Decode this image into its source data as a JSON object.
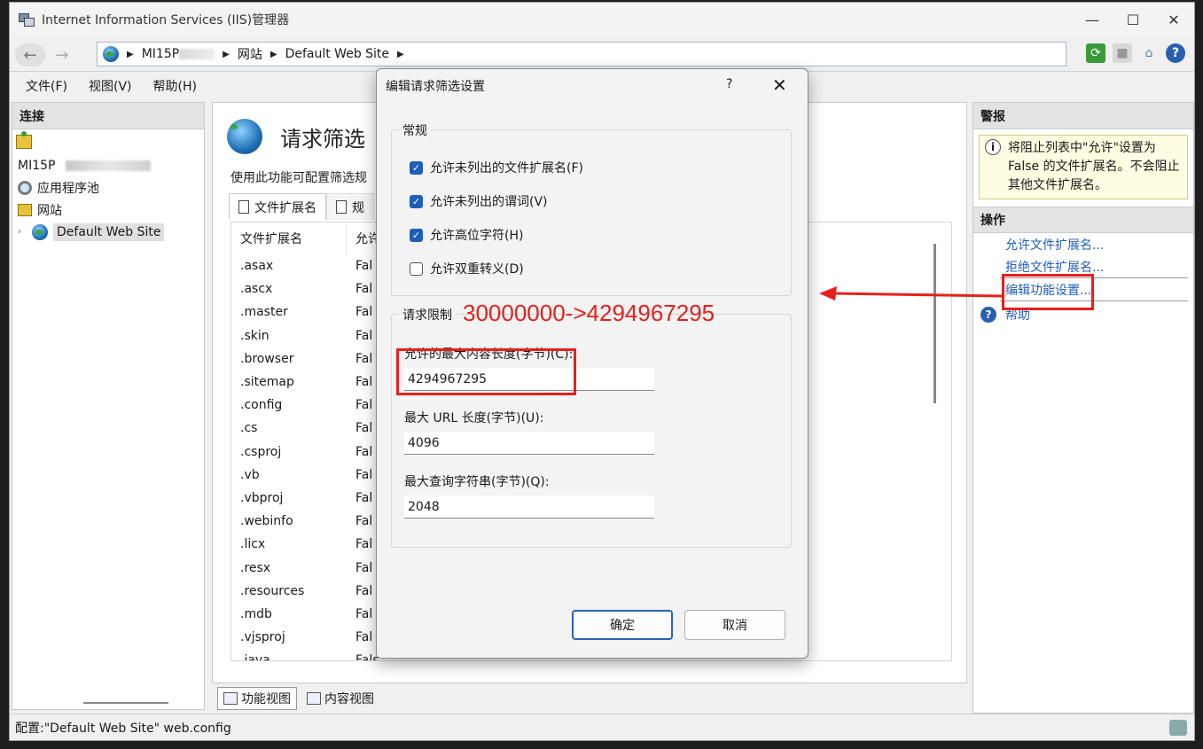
{
  "window": {
    "title": "Internet Information Services (IIS)管理器",
    "controls": {
      "minimize": "—",
      "maximize": "☐",
      "close": "✕"
    }
  },
  "address": {
    "crumbs": [
      "MI15P",
      "网站",
      "Default Web Site"
    ]
  },
  "menu": {
    "file": "文件(F)",
    "view": "视图(V)",
    "help": "帮助(H)"
  },
  "connections": {
    "header": "连接",
    "server": "MI15P",
    "app_pools": "应用程序池",
    "sites": "网站",
    "site": "Default Web Site"
  },
  "center": {
    "title": "请求筛选",
    "description": "使用此功能可配置筛选规",
    "tab_ext": "文件扩展名",
    "tab_rules": "规",
    "col_ext": "文件扩展名",
    "col_allowed": "允许",
    "rows": [
      [
        ".asax",
        "Fal"
      ],
      [
        ".ascx",
        "Fal"
      ],
      [
        ".master",
        "Fal"
      ],
      [
        ".skin",
        "Fal"
      ],
      [
        ".browser",
        "Fal"
      ],
      [
        ".sitemap",
        "Fal"
      ],
      [
        ".config",
        "Fal"
      ],
      [
        ".cs",
        "Fal"
      ],
      [
        ".csproj",
        "Fal"
      ],
      [
        ".vb",
        "Fal"
      ],
      [
        ".vbproj",
        "Fal"
      ],
      [
        ".webinfo",
        "Fal"
      ],
      [
        ".licx",
        "Fal"
      ],
      [
        ".resx",
        "Fal"
      ],
      [
        ".resources",
        "Fal"
      ],
      [
        ".mdb",
        "Fal"
      ],
      [
        ".vjsproj",
        "Fal"
      ],
      [
        ".java",
        "Fals"
      ]
    ],
    "view_features": "功能视图",
    "view_content": "内容视图"
  },
  "alerts": {
    "header": "警报",
    "message": "将阻止列表中\"允许\"设置为 False 的文件扩展名。不会阻止其他文件扩展名。"
  },
  "actions": {
    "header": "操作",
    "allow_ext": "允许文件扩展名...",
    "deny_ext": "拒绝文件扩展名...",
    "edit_settings": "编辑功能设置...",
    "help": "帮助"
  },
  "status": {
    "text": "配置:\"Default Web Site\" web.config"
  },
  "dialog": {
    "title": "编辑请求筛选设置",
    "help": "?",
    "close": "✕",
    "general_label": "常规",
    "chk_unlisted_ext": "允许未列出的文件扩展名(F)",
    "chk_unlisted_verbs": "允许未列出的谓词(V)",
    "chk_high_bit": "允许高位字符(H)",
    "chk_double_escape": "允许双重转义(D)",
    "limits_label": "请求限制",
    "max_content_label": "允许的最大内容长度(字节)(C):",
    "max_content_value": "4294967295",
    "max_url_label": "最大 URL 长度(字节)(U):",
    "max_url_value": "4096",
    "max_query_label": "最大查询字符串(字节)(Q):",
    "max_query_value": "2048",
    "ok": "确定",
    "cancel": "取消",
    "checked": [
      true,
      true,
      true,
      false
    ]
  },
  "annotation": {
    "text": "30000000->4294967295",
    "color": "#e8201a"
  }
}
